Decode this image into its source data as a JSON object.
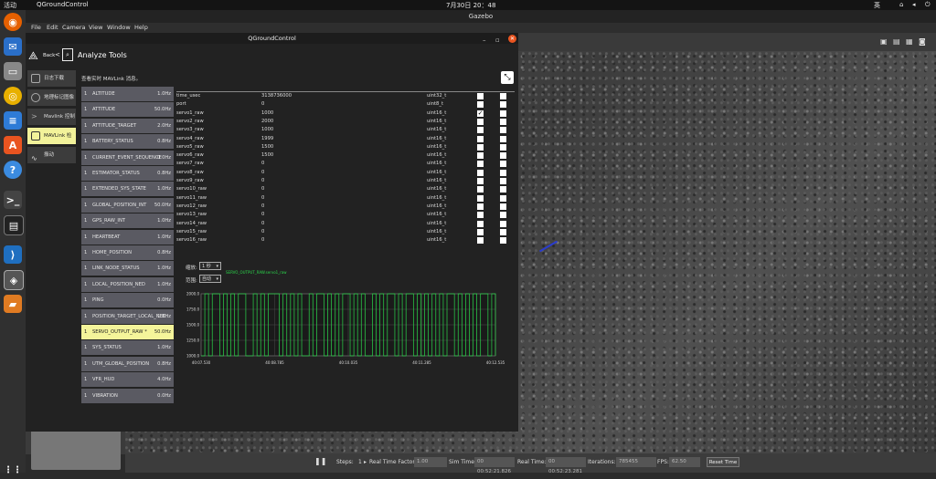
{
  "topbar": {
    "activities": "活动",
    "app": "QGroundControl",
    "clock": "7月30日 20：48",
    "lang": "英"
  },
  "gazebo": {
    "title": "Gazebo",
    "menu": [
      "File",
      "Edit",
      "Camera",
      "View",
      "Window",
      "Help"
    ],
    "bottom": {
      "steps_label": "Steps:",
      "steps_value": "1",
      "rtf_label": "Real Time Factor:",
      "rtf_value": "1.00",
      "sim_label": "Sim Time:",
      "sim_value": "00 00:52:21.826",
      "real_label": "Real Time:",
      "real_value": "00 00:52:23.281",
      "iter_label": "Iterations:",
      "iter_value": "785455",
      "fps_label": "FPS:",
      "fps_value": "62.50",
      "reset_label": "Reset Time"
    }
  },
  "qgc": {
    "window_title": "QGroundControl",
    "back_label": "Back",
    "page_title": "Analyze Tools",
    "subtitle": "查看实时 MAVLink 消息。",
    "nav": [
      {
        "label": "日志下载",
        "icon": "log-download-icon"
      },
      {
        "label": "地理标记图像",
        "icon": "geotag-icon"
      },
      {
        "label": "Mavlink 控制台",
        "icon": "console-icon"
      },
      {
        "label": "MAVLink 检测",
        "icon": "mavlink-inspector-icon"
      },
      {
        "label": "振动",
        "icon": "vibration-icon"
      }
    ],
    "messages": [
      {
        "idx": "1",
        "name": "ALTITUDE",
        "hz": "1.0Hz"
      },
      {
        "idx": "1",
        "name": "ATTITUDE",
        "hz": "50.0Hz"
      },
      {
        "idx": "1",
        "name": "ATTITUDE_TARGET",
        "hz": "2.0Hz"
      },
      {
        "idx": "1",
        "name": "BATTERY_STATUS",
        "hz": "0.8Hz"
      },
      {
        "idx": "1",
        "name": "CURRENT_EVENT_SEQUENCE",
        "hz": "0.0Hz"
      },
      {
        "idx": "1",
        "name": "ESTIMATOR_STATUS",
        "hz": "0.8Hz"
      },
      {
        "idx": "1",
        "name": "EXTENDED_SYS_STATE",
        "hz": "1.0Hz"
      },
      {
        "idx": "1",
        "name": "GLOBAL_POSITION_INT",
        "hz": "50.0Hz"
      },
      {
        "idx": "1",
        "name": "GPS_RAW_INT",
        "hz": "1.0Hz"
      },
      {
        "idx": "1",
        "name": "HEARTBEAT",
        "hz": "1.0Hz"
      },
      {
        "idx": "1",
        "name": "HOME_POSITION",
        "hz": "0.8Hz"
      },
      {
        "idx": "1",
        "name": "LINK_NODE_STATUS",
        "hz": "1.0Hz"
      },
      {
        "idx": "1",
        "name": "LOCAL_POSITION_NED",
        "hz": "1.0Hz"
      },
      {
        "idx": "1",
        "name": "PING",
        "hz": "0.0Hz"
      },
      {
        "idx": "1",
        "name": "POSITION_TARGET_LOCAL_NED",
        "hz": "1.8Hz"
      },
      {
        "idx": "1",
        "name": "SERVO_OUTPUT_RAW *",
        "hz": "50.0Hz"
      },
      {
        "idx": "1",
        "name": "SYS_STATUS",
        "hz": "1.0Hz"
      },
      {
        "idx": "1",
        "name": "UTM_GLOBAL_POSITION",
        "hz": "0.8Hz"
      },
      {
        "idx": "1",
        "name": "VFR_HUD",
        "hz": "4.0Hz"
      },
      {
        "idx": "1",
        "name": "VIBRATION",
        "hz": "0.0Hz"
      }
    ],
    "fields": [
      {
        "name": "time_usec",
        "value": "3138736000",
        "type": "uint32_t",
        "c1": false,
        "c2": false
      },
      {
        "name": "port",
        "value": "0",
        "type": "uint8_t",
        "c1": false,
        "c2": false
      },
      {
        "name": "servo1_raw",
        "value": "1000",
        "type": "uint16_t",
        "c1": true,
        "c2": false
      },
      {
        "name": "servo2_raw",
        "value": "2000",
        "type": "uint16_t",
        "c1": false,
        "c2": false
      },
      {
        "name": "servo3_raw",
        "value": "1000",
        "type": "uint16_t",
        "c1": false,
        "c2": false
      },
      {
        "name": "servo4_raw",
        "value": "1999",
        "type": "uint16_t",
        "c1": false,
        "c2": false
      },
      {
        "name": "servo5_raw",
        "value": "1500",
        "type": "uint16_t",
        "c1": false,
        "c2": false
      },
      {
        "name": "servo6_raw",
        "value": "1500",
        "type": "uint16_t",
        "c1": false,
        "c2": false
      },
      {
        "name": "servo7_raw",
        "value": "0",
        "type": "uint16_t",
        "c1": false,
        "c2": false
      },
      {
        "name": "servo8_raw",
        "value": "0",
        "type": "uint16_t",
        "c1": false,
        "c2": false
      },
      {
        "name": "servo9_raw",
        "value": "0",
        "type": "uint16_t",
        "c1": false,
        "c2": false
      },
      {
        "name": "servo10_raw",
        "value": "0",
        "type": "uint16_t",
        "c1": false,
        "c2": false
      },
      {
        "name": "servo11_raw",
        "value": "0",
        "type": "uint16_t",
        "c1": false,
        "c2": false
      },
      {
        "name": "servo12_raw",
        "value": "0",
        "type": "uint16_t",
        "c1": false,
        "c2": false
      },
      {
        "name": "servo13_raw",
        "value": "0",
        "type": "uint16_t",
        "c1": false,
        "c2": false
      },
      {
        "name": "servo14_raw",
        "value": "0",
        "type": "uint16_t",
        "c1": false,
        "c2": false
      },
      {
        "name": "servo15_raw",
        "value": "0",
        "type": "uint16_t",
        "c1": false,
        "c2": false
      },
      {
        "name": "servo16_raw",
        "value": "0",
        "type": "uint16_t",
        "c1": false,
        "c2": false
      }
    ],
    "scale_label": "缩放:",
    "scale_value": "1 秒",
    "range_label": "范围:",
    "range_value": "自动"
  },
  "chart_data": {
    "type": "line",
    "series_label": "SERVO_OUTPUT_RAW.servo1_raw",
    "series_color": "#2bd64b",
    "ylim": [
      1000,
      2000
    ],
    "yticks": [
      "2000.0",
      "1750.0",
      "1500.0",
      "1250.0",
      "1000.0"
    ],
    "xticks": [
      "40:07.530",
      "40:08.785",
      "40:10.035",
      "40:11.285",
      "40:12.535"
    ],
    "values": [
      1000,
      2000,
      1000,
      2000,
      2000,
      1000,
      2000,
      1000,
      2000,
      1000,
      2000,
      2000,
      1000,
      1000,
      2000,
      1000,
      2000,
      1000,
      2000,
      2000,
      2000,
      1000,
      2000,
      1000,
      2000,
      1000,
      2000,
      1000,
      1000,
      2000,
      1000,
      2000,
      2000,
      1000,
      2000,
      1000,
      2000,
      1000,
      2000,
      2000,
      1000,
      2000,
      1000,
      2000,
      1000,
      1000,
      2000,
      1000,
      2000,
      1000,
      2000,
      2000,
      1000,
      2000,
      1000,
      2000,
      2000,
      1000,
      2000,
      1000,
      2000,
      1000,
      2000,
      1000,
      2000,
      1000,
      2000,
      2000,
      1000,
      2000,
      1000,
      2000,
      1000,
      2000,
      1000,
      2000,
      2000,
      1000,
      2000,
      1000
    ]
  }
}
